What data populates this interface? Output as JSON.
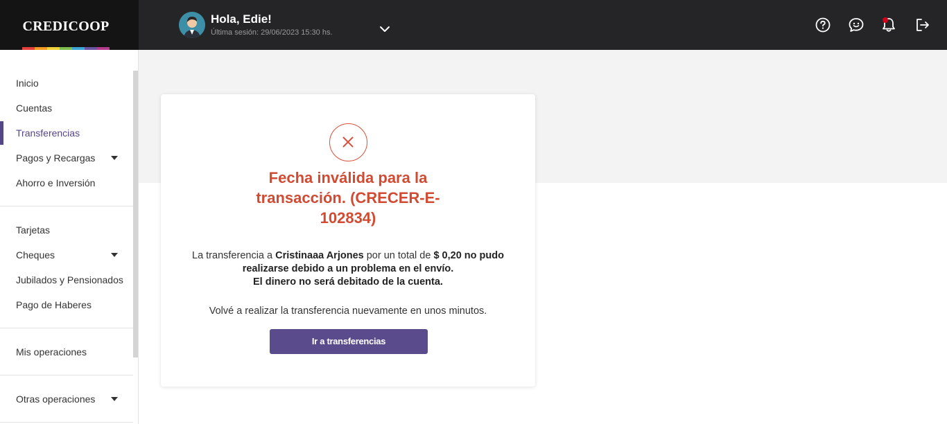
{
  "brand": {
    "name": "CREDICOOP",
    "stripe_colors": [
      "#e5403b",
      "#f59a23",
      "#f2d23b",
      "#7fbf4d",
      "#3ca6d8",
      "#6a55a3",
      "#b43a8c"
    ]
  },
  "header": {
    "greeting": "Hola, Edie!",
    "last_session": "Última sesión: 29/06/2023 15:30 hs.",
    "icons": [
      "help-icon",
      "chat-icon",
      "notification-bell-icon",
      "logout-icon"
    ],
    "notification_dot_color": "#d0021b"
  },
  "sidebar": {
    "group1": [
      {
        "label": "Inicio"
      },
      {
        "label": "Cuentas"
      },
      {
        "label": "Transferencias",
        "active": true
      },
      {
        "label": "Pagos y Recargas",
        "expandable": true
      },
      {
        "label": "Ahorro e Inversión"
      }
    ],
    "group2": [
      {
        "label": "Tarjetas"
      },
      {
        "label": "Cheques",
        "expandable": true
      },
      {
        "label": "Jubilados y Pensionados"
      },
      {
        "label": "Pago de Haberes"
      }
    ],
    "group3": [
      {
        "label": "Mis operaciones"
      }
    ],
    "group4": [
      {
        "label": "Otras operaciones",
        "expandable": true
      }
    ],
    "active_color": "#55468a"
  },
  "modal": {
    "title_line1": "Fecha inválida para la",
    "title_line2": "transacción. (CRECER-E-",
    "title_line3": "102834)",
    "msg_prefix": "La transferencia a ",
    "recipient": "Cristinaaa Arjones",
    "msg_mid": " por un total de ",
    "amount_text": "$ 0,20 no pudo",
    "msg_line2": "realizarse debido a un problema en el envío.",
    "msg_line3": "El dinero no será debitado de la cuenta.",
    "retry_text": "Volvé a realizar la transferencia nuevamente en unos minutos.",
    "button_label": "Ir a transferencias",
    "error_color": "#d14b33",
    "button_color": "#5a4b8d"
  }
}
